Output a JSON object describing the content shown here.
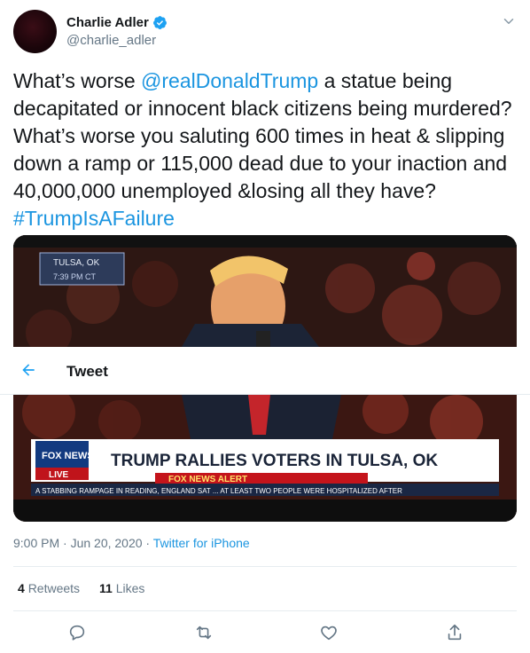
{
  "author": {
    "name": "Charlie Adler",
    "handle": "@charlie_adler",
    "verified": true
  },
  "tweet": {
    "segments": [
      {
        "text": "What’s worse ",
        "link": false
      },
      {
        "text": "@realDonaldTrump",
        "link": true
      },
      {
        "text": " a statue being decapitated or innocent black citizens being murdered? What’s  worse you saluting 600 times in heat & slipping down a ramp or 115,000 dead due to your inaction and 40,000,000 unemployed &losing all they have? ",
        "link": false
      },
      {
        "text": "#TrumpIsAFailure",
        "link": true
      }
    ]
  },
  "media": {
    "location_chyron": "TULSA, OK",
    "time_chyron": "7:39 PM CT",
    "network": "FOX NEWS",
    "live_label": "LIVE",
    "headline": "TRUMP RALLIES VOTERS IN TULSA, OK",
    "alert": "FOX NEWS ALERT",
    "ticker": "A STABBING RAMPAGE IN READING, ENGLAND SAT ... AT LEAST TWO PEOPLE WERE HOSPITALIZED AFTER"
  },
  "overlay": {
    "title": "Tweet"
  },
  "meta": {
    "timestamp": "9:00 PM · Jun 20, 2020 · ",
    "source": "Twitter for iPhone"
  },
  "stats": {
    "retweets_count": "4",
    "retweets_label": "Retweets",
    "likes_count": "11",
    "likes_label": "Likes"
  },
  "icons": {
    "reply": "reply-icon",
    "retweet": "retweet-icon",
    "like": "heart-icon",
    "share": "share-icon"
  },
  "colors": {
    "link": "#1b95e0",
    "secondary_text": "#657786",
    "divider": "#e6ecf0"
  }
}
